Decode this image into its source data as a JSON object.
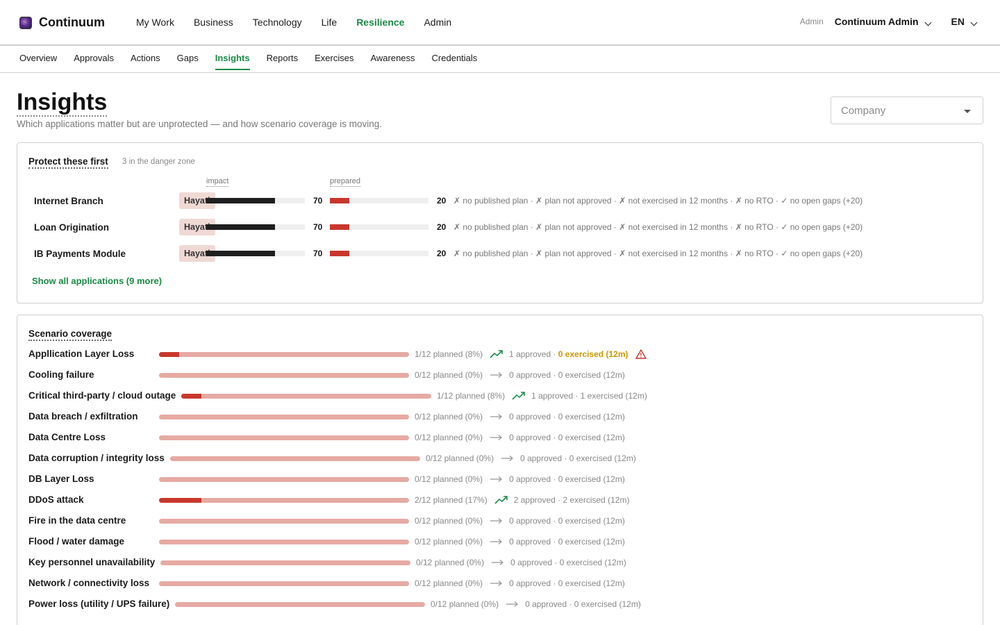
{
  "brand": {
    "name": "Continuum"
  },
  "main_nav": [
    {
      "label": "My Work",
      "active": false
    },
    {
      "label": "Business",
      "active": false
    },
    {
      "label": "Technology",
      "active": false
    },
    {
      "label": "Life",
      "active": false
    },
    {
      "label": "Resilience",
      "active": true
    },
    {
      "label": "Admin",
      "active": false
    }
  ],
  "user": {
    "role": "Admin",
    "name": "Continuum Admin",
    "language": "EN"
  },
  "sub_nav": [
    {
      "label": "Overview",
      "active": false
    },
    {
      "label": "Approvals",
      "active": false
    },
    {
      "label": "Actions",
      "active": false
    },
    {
      "label": "Gaps",
      "active": false
    },
    {
      "label": "Insights",
      "active": true
    },
    {
      "label": "Reports",
      "active": false
    },
    {
      "label": "Exercises",
      "active": false
    },
    {
      "label": "Awareness",
      "active": false
    },
    {
      "label": "Credentials",
      "active": false
    }
  ],
  "page": {
    "title": "Insights",
    "subtitle": "Which applications matter but are unprotected — and how scenario coverage is moving.",
    "company_placeholder": "Company"
  },
  "protect": {
    "title": "Protect these first",
    "count_text": "3 in the danger zone",
    "impact_label": "impact",
    "prepared_label": "prepared",
    "show_all": "Show all applications (9 more)",
    "impact_max": 100,
    "prepared_max": 100,
    "rows": [
      {
        "name": "Internet Branch",
        "owner": "Hayati",
        "impact": 70,
        "prepared": 20,
        "reasons": "✗ no published plan · ✗ plan not approved · ✗ not exercised in 12 months · ✗ no RTO · ✓ no open gaps (+20)"
      },
      {
        "name": "Loan Origination",
        "owner": "Hayati",
        "impact": 70,
        "prepared": 20,
        "reasons": "✗ no published plan · ✗ plan not approved · ✗ not exercised in 12 months · ✗ no RTO · ✓ no open gaps (+20)"
      },
      {
        "name": "IB Payments Module",
        "owner": "Hayati",
        "impact": 70,
        "prepared": 20,
        "reasons": "✗ no published plan · ✗ plan not approved · ✗ not exercised in 12 months · ✗ no RTO · ✓ no open gaps (+20)"
      }
    ]
  },
  "scenario": {
    "title": "Scenario coverage",
    "colors": {
      "fill": "#c9372c",
      "track": "#e6aaa3",
      "trend_up": "#1a8a45",
      "warn": "#c99700",
      "alert": "#c9372c"
    },
    "rows": [
      {
        "name": "Appllication Layer Loss",
        "planned_fraction": 0.08,
        "planned_text": "1/12 planned (8%)",
        "trend": "up",
        "approved_text": "1 approved",
        "exercised_text": "0 exercised (12m)",
        "warning": true
      },
      {
        "name": "Cooling failure",
        "planned_fraction": 0,
        "planned_text": "0/12 planned (0%)",
        "trend": "flat",
        "approved_text": "0 approved",
        "exercised_text": "0 exercised (12m)",
        "warning": false
      },
      {
        "name": "Critical third-party / cloud outage",
        "planned_fraction": 0.08,
        "planned_text": "1/12 planned (8%)",
        "trend": "up",
        "approved_text": "1 approved",
        "exercised_text": "1 exercised (12m)",
        "warning": false
      },
      {
        "name": "Data breach / exfiltration",
        "planned_fraction": 0,
        "planned_text": "0/12 planned (0%)",
        "trend": "flat",
        "approved_text": "0 approved",
        "exercised_text": "0 exercised (12m)",
        "warning": false
      },
      {
        "name": "Data Centre Loss",
        "planned_fraction": 0,
        "planned_text": "0/12 planned (0%)",
        "trend": "flat",
        "approved_text": "0 approved",
        "exercised_text": "0 exercised (12m)",
        "warning": false
      },
      {
        "name": "Data corruption / integrity loss",
        "planned_fraction": 0,
        "planned_text": "0/12 planned (0%)",
        "trend": "flat",
        "approved_text": "0 approved",
        "exercised_text": "0 exercised (12m)",
        "warning": false
      },
      {
        "name": "DB Layer Loss",
        "planned_fraction": 0,
        "planned_text": "0/12 planned (0%)",
        "trend": "flat",
        "approved_text": "0 approved",
        "exercised_text": "0 exercised (12m)",
        "warning": false
      },
      {
        "name": "DDoS attack",
        "planned_fraction": 0.17,
        "planned_text": "2/12 planned (17%)",
        "trend": "up",
        "approved_text": "2 approved",
        "exercised_text": "2 exercised (12m)",
        "warning": false
      },
      {
        "name": "Fire in the data centre",
        "planned_fraction": 0,
        "planned_text": "0/12 planned (0%)",
        "trend": "flat",
        "approved_text": "0 approved",
        "exercised_text": "0 exercised (12m)",
        "warning": false
      },
      {
        "name": "Flood / water damage",
        "planned_fraction": 0,
        "planned_text": "0/12 planned (0%)",
        "trend": "flat",
        "approved_text": "0 approved",
        "exercised_text": "0 exercised (12m)",
        "warning": false
      },
      {
        "name": "Key personnel unavailability",
        "planned_fraction": 0,
        "planned_text": "0/12 planned (0%)",
        "trend": "flat",
        "approved_text": "0 approved",
        "exercised_text": "0 exercised (12m)",
        "warning": false
      },
      {
        "name": "Network / connectivity loss",
        "planned_fraction": 0,
        "planned_text": "0/12 planned (0%)",
        "trend": "flat",
        "approved_text": "0 approved",
        "exercised_text": "0 exercised (12m)",
        "warning": false
      },
      {
        "name": "Power loss (utility / UPS failure)",
        "planned_fraction": 0,
        "planned_text": "0/12 planned (0%)",
        "trend": "flat",
        "approved_text": "0 approved",
        "exercised_text": "0 exercised (12m)",
        "warning": false
      }
    ]
  }
}
